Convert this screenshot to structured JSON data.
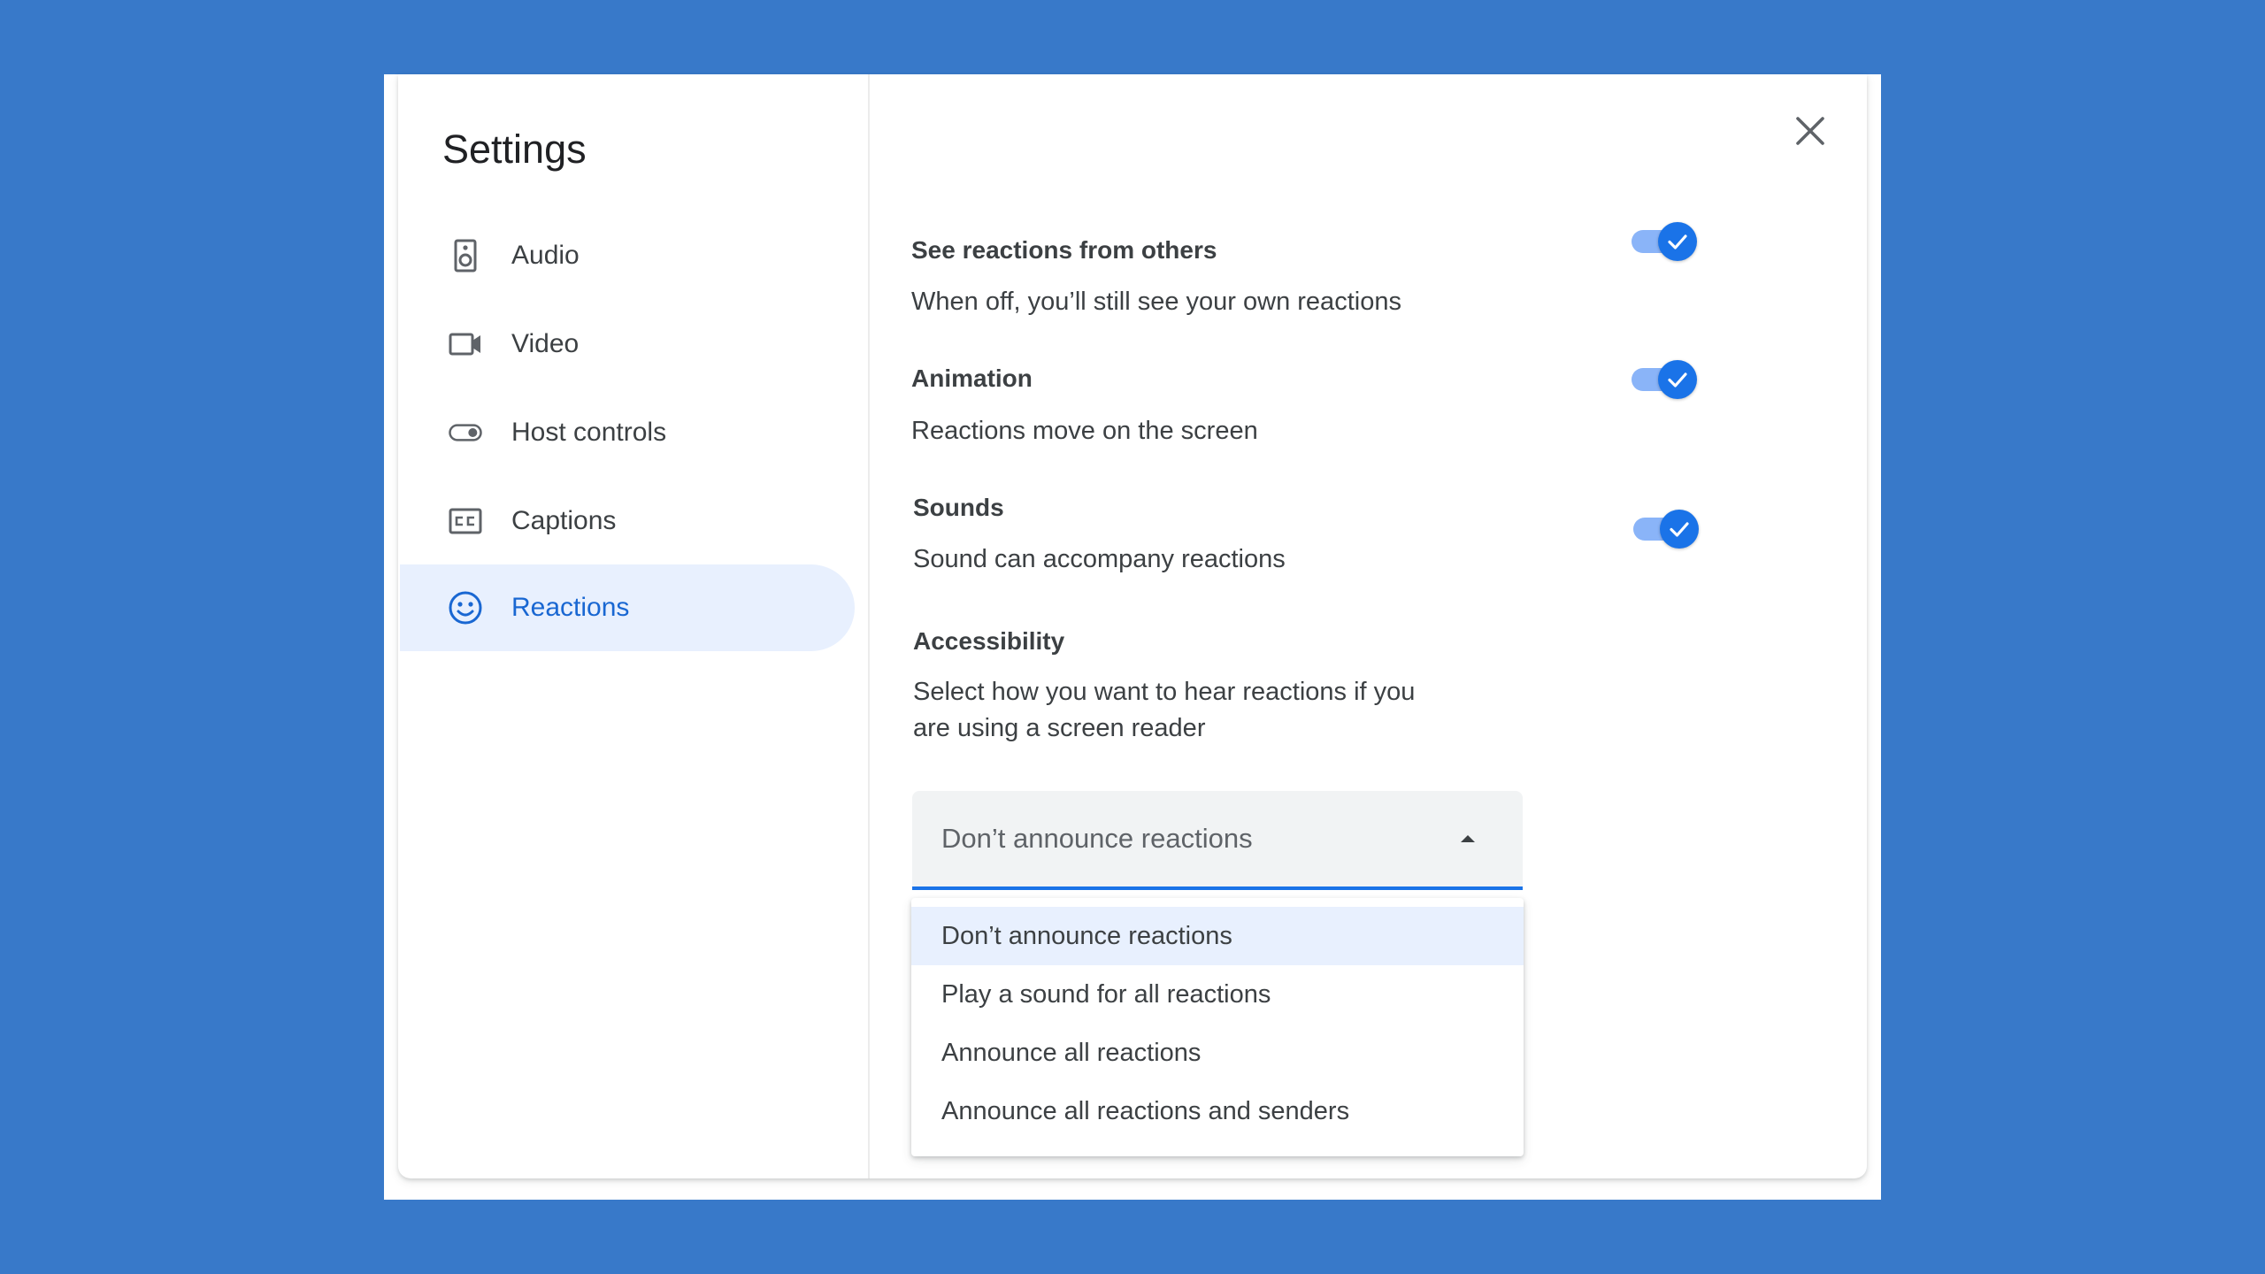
{
  "dialog": {
    "title": "Settings",
    "close_icon": "close-icon"
  },
  "sidebar": {
    "items": [
      {
        "label": "Audio",
        "icon": "speaker-icon",
        "active": false
      },
      {
        "label": "Video",
        "icon": "videocam-icon",
        "active": false
      },
      {
        "label": "Host controls",
        "icon": "toggle-icon",
        "active": false
      },
      {
        "label": "Captions",
        "icon": "closed-captions-icon",
        "active": false
      },
      {
        "label": "Reactions",
        "icon": "smiley-face-icon",
        "active": true
      }
    ]
  },
  "settings": {
    "see_reactions": {
      "title": "See reactions from others",
      "description": "When off, you’ll still see your own reactions",
      "enabled": true
    },
    "animation": {
      "title": "Animation",
      "description": "Reactions move on the screen",
      "enabled": true
    },
    "sounds": {
      "title": "Sounds",
      "description": "Sound can accompany reactions",
      "enabled": true
    },
    "accessibility": {
      "title": "Accessibility",
      "description_line1": "Select how you want to hear reactions if you",
      "description_line2": "are using a screen reader",
      "selected": "Don’t announce reactions",
      "options": [
        "Don’t announce reactions",
        "Play a sound for all reactions",
        "Announce all reactions",
        "Announce all reactions and senders"
      ]
    }
  },
  "colors": {
    "background": "#3879C9",
    "accent": "#1a73e8",
    "active_nav_bg": "#e8f0fe",
    "active_nav_text": "#1967d2"
  }
}
